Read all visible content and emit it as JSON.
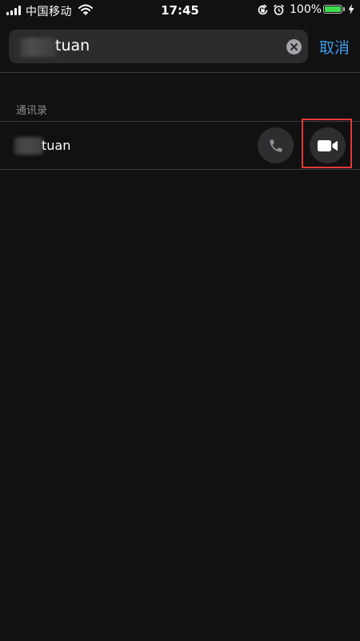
{
  "status_bar": {
    "carrier": "中国移动",
    "time": "17:45",
    "battery_percent": "100%",
    "battery_level": 1.0,
    "icons": [
      "signal-icon",
      "wifi-icon",
      "orientation-lock-icon",
      "alarm-icon",
      "battery-icon",
      "charging-bolt-icon"
    ]
  },
  "search": {
    "query_visible": "tuan",
    "clear_icon": "clear-icon",
    "cancel_label": "取消"
  },
  "results": {
    "section_title": "通讯录",
    "contacts": [
      {
        "name_visible": "tuan",
        "actions": [
          "phone-icon",
          "video-camera-icon"
        ]
      }
    ]
  },
  "colors": {
    "background": "#111111",
    "search_field": "#2c2c2e",
    "accent_blue": "#3d9be9",
    "action_button": "#2e2e30",
    "highlight_red": "#e53935",
    "battery_green": "#3ddc4e",
    "secondary_text": "#8e8e93"
  }
}
